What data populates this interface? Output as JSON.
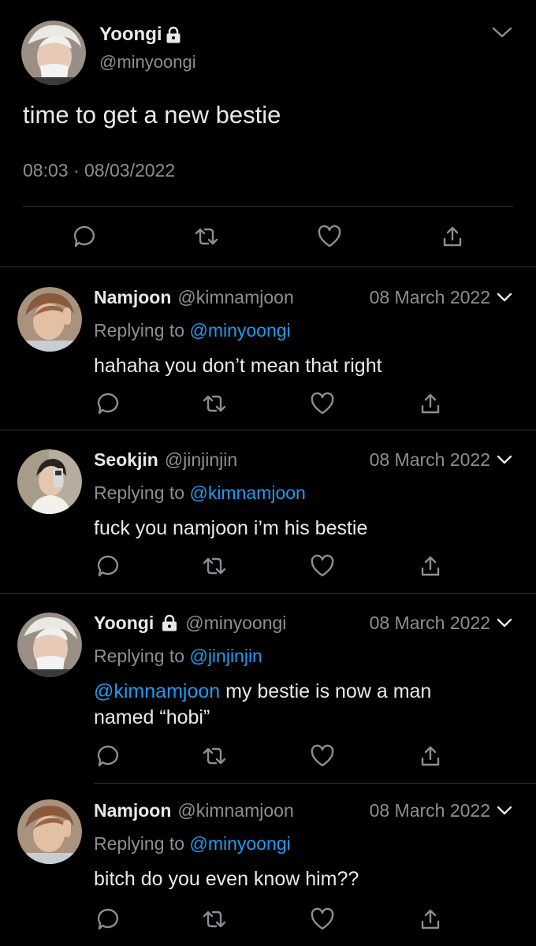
{
  "main_tweet": {
    "author_name": "Yoongi",
    "author_handle": "@minyoongi",
    "protected_icon": "lock-icon",
    "text": "time to get a new bestie",
    "time": "08:03",
    "separator": "·",
    "date": "08/03/2022",
    "actions": [
      "reply-icon",
      "retweet-icon",
      "like-icon",
      "share-icon"
    ]
  },
  "replies": [
    {
      "author_name": "Namjoon",
      "author_handle": "@kimnamjoon",
      "date": "08 March 2022",
      "replying_prefix": "Replying to",
      "replying_to": "@minyoongi",
      "text": "hahaha you don’t mean that right"
    },
    {
      "author_name": "Seokjin",
      "author_handle": "@jinjinjin",
      "date": "08 March 2022",
      "replying_prefix": "Replying to",
      "replying_to": "@kimnamjoon",
      "text": "fuck you namjoon i’m his bestie"
    },
    {
      "author_name": "Yoongi",
      "author_handle": "@minyoongi",
      "date": "08 March 2022",
      "replying_prefix": "Replying to",
      "replying_to": "@jinjinjin",
      "text_mention": "@kimnamjoon",
      "text_line1": " my bestie is now a man",
      "text_line2": "named “hobi”"
    },
    {
      "author_name": "Namjoon",
      "author_handle": "@kimnamjoon",
      "date": "08 March 2022",
      "replying_prefix": "Replying to",
      "replying_to": "@minyoongi",
      "text": "bitch do you even know him??"
    }
  ],
  "colors": {
    "background": "#000000",
    "text": "#e7e9ea",
    "secondary": "#8b8f94",
    "mention": "#1d9bf0",
    "divider": "#2f3336"
  }
}
